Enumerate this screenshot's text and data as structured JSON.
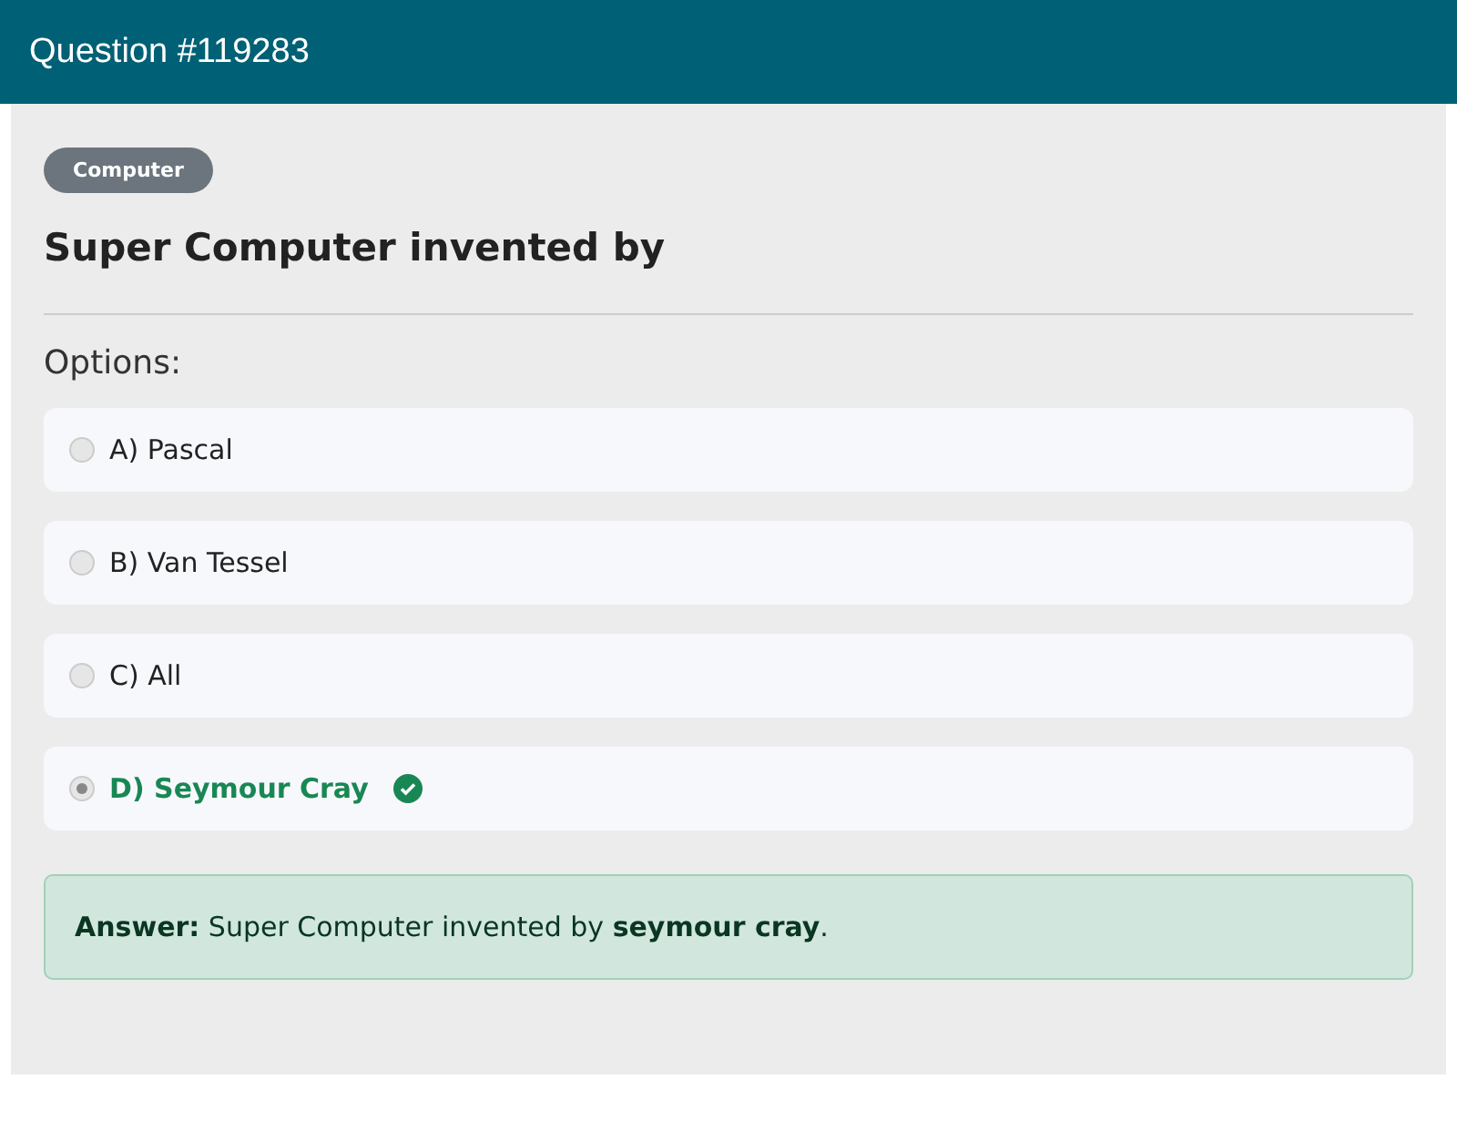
{
  "header": {
    "title": "Question #119283"
  },
  "category": "Computer",
  "question": "Super Computer invented by",
  "options_label": "Options:",
  "options": [
    {
      "label": "A) Pascal",
      "selected": false,
      "correct": false
    },
    {
      "label": "B) Van Tessel",
      "selected": false,
      "correct": false
    },
    {
      "label": "C) All",
      "selected": false,
      "correct": false
    },
    {
      "label": "D) Seymour Cray",
      "selected": true,
      "correct": true
    }
  ],
  "answer": "**Answer:** Super Computer invented by **seymour cray**."
}
